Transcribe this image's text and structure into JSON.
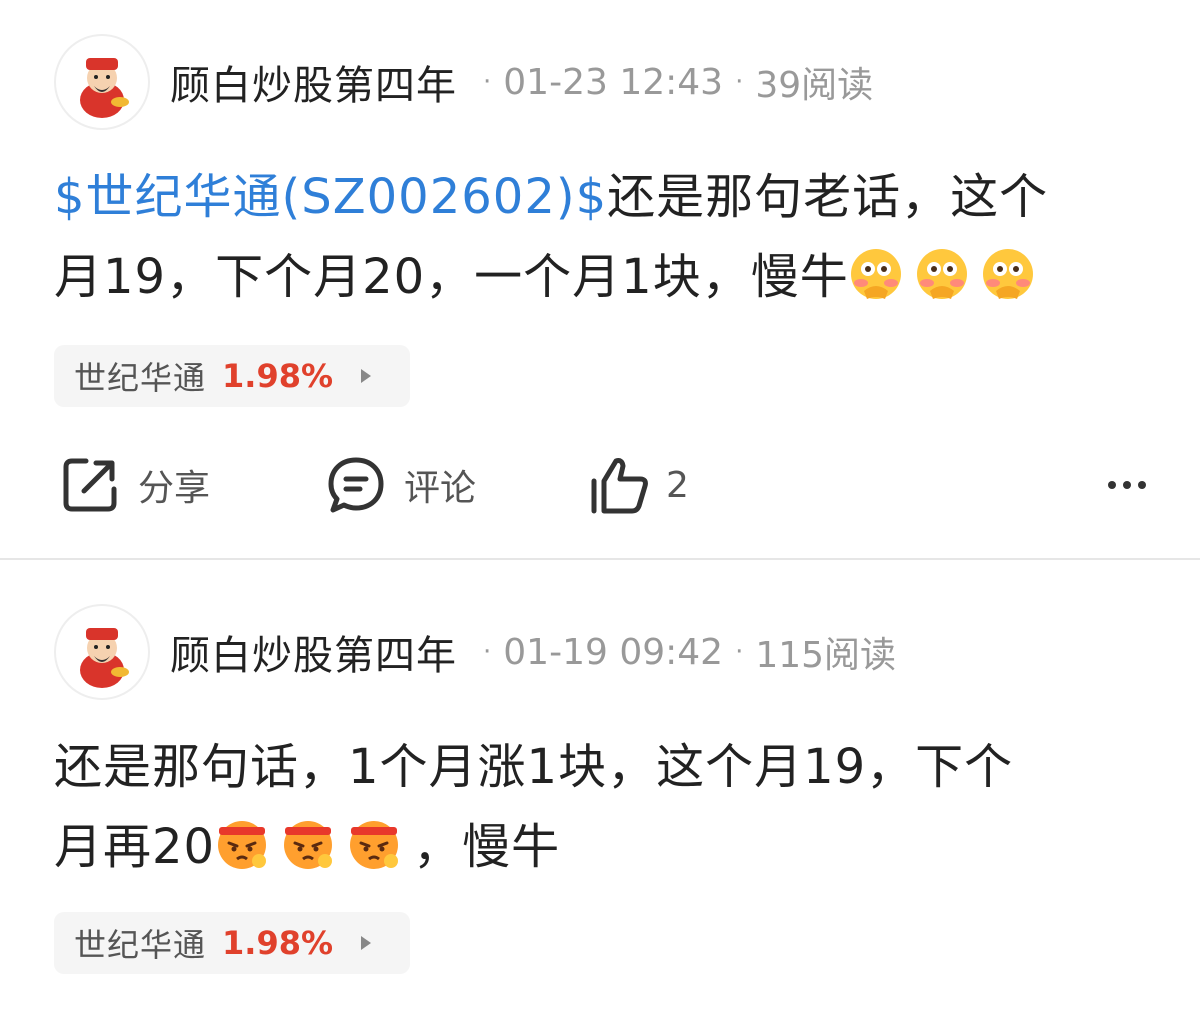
{
  "posts": [
    {
      "author": "顾白炒股第四年",
      "date": "01-23 12:43",
      "reads": "39阅读",
      "stock_link": "$世纪华通(SZ002602)$",
      "line1_rest": "还是那句老话，这个",
      "line2": "月19，下个月20，一个月1块，慢牛",
      "emoji": "flushed-hand-emoji",
      "stock_chip": {
        "name": "世纪华通",
        "change": "1.98%"
      },
      "actions": {
        "share": "分享",
        "comment": "评论",
        "likes": "2"
      }
    },
    {
      "author": "顾白炒股第四年",
      "date": "01-19 09:42",
      "reads": "115阅读",
      "line1": "还是那句话，1个月涨1块，这个月19，下个",
      "line2_a": "月再20",
      "line2_b": "，慢牛",
      "emoji": "angry-headband-emoji",
      "stock_chip": {
        "name": "世纪华通",
        "change": "1.98%"
      }
    }
  ],
  "colors": {
    "link": "#2f7fd8",
    "gain": "#e0412c",
    "meta": "#999999"
  }
}
